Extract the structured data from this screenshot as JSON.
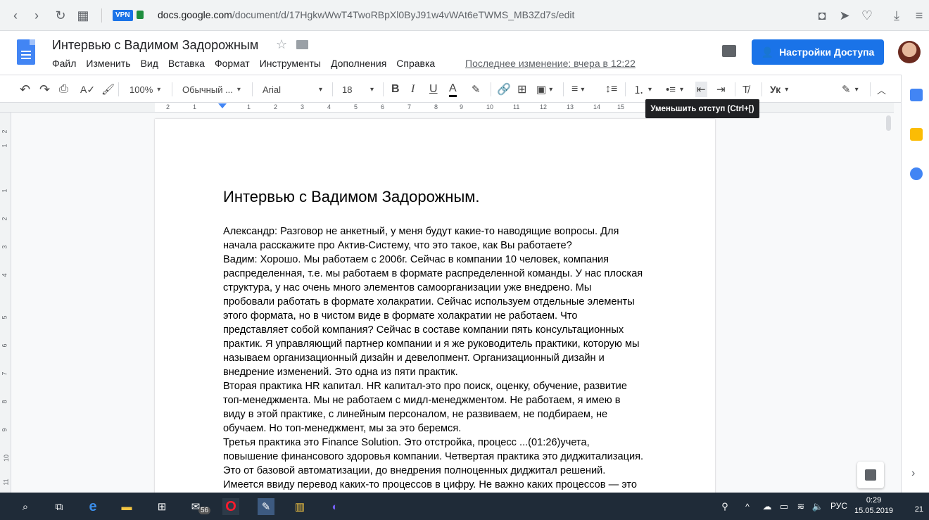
{
  "browser": {
    "vpn_label": "VPN",
    "url_host": "docs.google.com",
    "url_path": "/document/d/17HgkwWwT4TwoRBpXl0ByJ91w4vWAt6eTWMS_MB3Zd7s/edit",
    "url_prefix": "docs."
  },
  "header": {
    "title": "Интервью с Вадимом Задорожным",
    "menus": [
      "Файл",
      "Изменить",
      "Вид",
      "Вставка",
      "Формат",
      "Инструменты",
      "Дополнения",
      "Справка"
    ],
    "last_edit": "Последнее изменение: вчера в 12:22",
    "share_label": "Настройки Доступа"
  },
  "toolbar": {
    "zoom": "100%",
    "style": "Обычный ...",
    "font": "Arial",
    "font_size": "18",
    "language": "Ук"
  },
  "tooltip": "Уменьшить отступ (Ctrl+[)",
  "ruler": {
    "numbers": [
      "2",
      "1",
      "1",
      "2",
      "3",
      "4",
      "5",
      "6",
      "7",
      "8",
      "9",
      "10",
      "11",
      "12",
      "13",
      "14",
      "15"
    ],
    "vnumbers": [
      "2",
      "1",
      "1",
      "2",
      "3",
      "4",
      "5",
      "6",
      "7",
      "8",
      "9",
      "10",
      "11"
    ]
  },
  "document": {
    "heading": "Интервью с Вадимом Задорожным.",
    "lines": [
      "Александр: Разговор не анкетный, у меня будут какие-то наводящие вопросы. Для",
      "начала расскажите про Актив-Систему, что это такое, как Вы работаете?",
      "Вадим: Хорошо. Мы работаем с 2006г. Сейчас в компании 10 человек, компания",
      "распределенная, т.е. мы работаем в формате распределенной команды. У нас плоская",
      "структура, у нас очень много элементов самоорганизации уже внедрено. Мы",
      "пробовали работать в формате холакратии. Сейчас используем отдельные элементы",
      "этого формата, но в чистом виде в формате холакратии не работаем. Что",
      "представляет собой компания? Сейчас в составе компании пять консультационных",
      "практик. Я управляющий партнер компании и я же руководитель практики, которую мы",
      "называем организационный дизайн и девелопмент. Организационный дизайн и",
      "внедрение изменений. Это одна из пяти практик.",
      "Вторая практика HR капитал. HR капитал-это про поиск, оценку, обучение, развитие",
      "топ-менеджмента.  Мы не работаем с мидл-менеджментом. Не работаем, я имею в",
      "виду в этой практике, с линейным персоналом, не развиваем, не подбираем, не",
      "обучаем. Но топ-менеджмент, мы за это беремся.",
      "Третья практика это Finance Solution. Это отстройка, процесс ...(01:26)учета,",
      "повышение финансового здоровья компании. Четвертая практика это диджитализация.",
      "Это от базовой автоматизации, до внедрения полноценных диджитал решений.",
      "Имеется ввиду перевод каких-то процессов в цифру. Не важно каких процессов — это"
    ]
  },
  "taskbar": {
    "mail_badge": "56",
    "language": "РУС",
    "time": "0:29",
    "date": "15.05.2019",
    "notifications": "21"
  }
}
